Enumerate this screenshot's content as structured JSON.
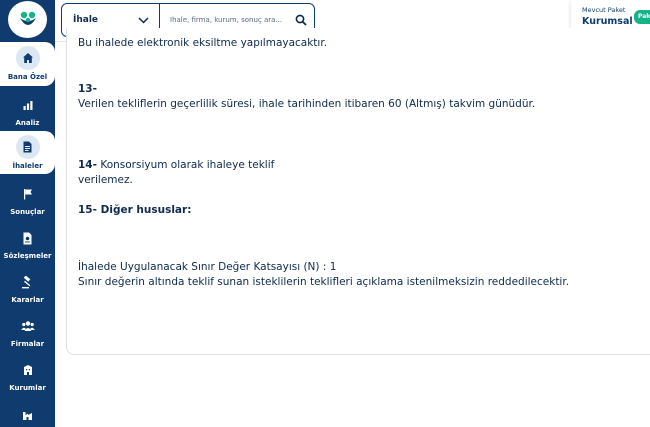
{
  "sidebar": {
    "items": [
      {
        "label": "Bana Özel",
        "icon": "home-icon"
      },
      {
        "label": "Analiz",
        "icon": "bar-chart-icon"
      },
      {
        "label": "İhaleler",
        "icon": "document-icon"
      },
      {
        "label": "Sonuçlar",
        "icon": "flag-icon"
      },
      {
        "label": "Sözleşmeler",
        "icon": "contract-icon"
      },
      {
        "label": "Kararlar",
        "icon": "gavel-icon"
      },
      {
        "label": "Firmalar",
        "icon": "people-icon"
      },
      {
        "label": "Kurumlar",
        "icon": "building-icon"
      }
    ]
  },
  "search": {
    "category": "İhale",
    "placeholder": "İhale, firma, kurum, sonuç ara..."
  },
  "package": {
    "caption": "Mevcut Paket",
    "name": "Kurumsal",
    "badge": "Paket"
  },
  "content": {
    "line_top": "Bu ihalede elektronik eksiltme yapılmayacaktır.",
    "item13_num": "13-",
    "item13_text": "Verilen tekliflerin geçerlilik süresi, ihale tarihinden itibaren 60 (Altmış) takvim günüdür.",
    "item14_num": "14-",
    "item14_text": "Konsorsiyum olarak ihaleye teklif",
    "item14_text2": "verilemez.",
    "item15": "15- Diğer hususlar:",
    "limit_line1": "İhalede Uygulanacak Sınır Değer Katsayısı (N) : 1",
    "limit_line2": "Sınır değerin altında teklif sunan isteklilerin teklifleri açıklama istenilmeksizin reddedilecektir."
  },
  "colors": {
    "sidebar": "#0f3b6e",
    "accent_green": "#14b38a",
    "text": "#0f2a4d"
  }
}
